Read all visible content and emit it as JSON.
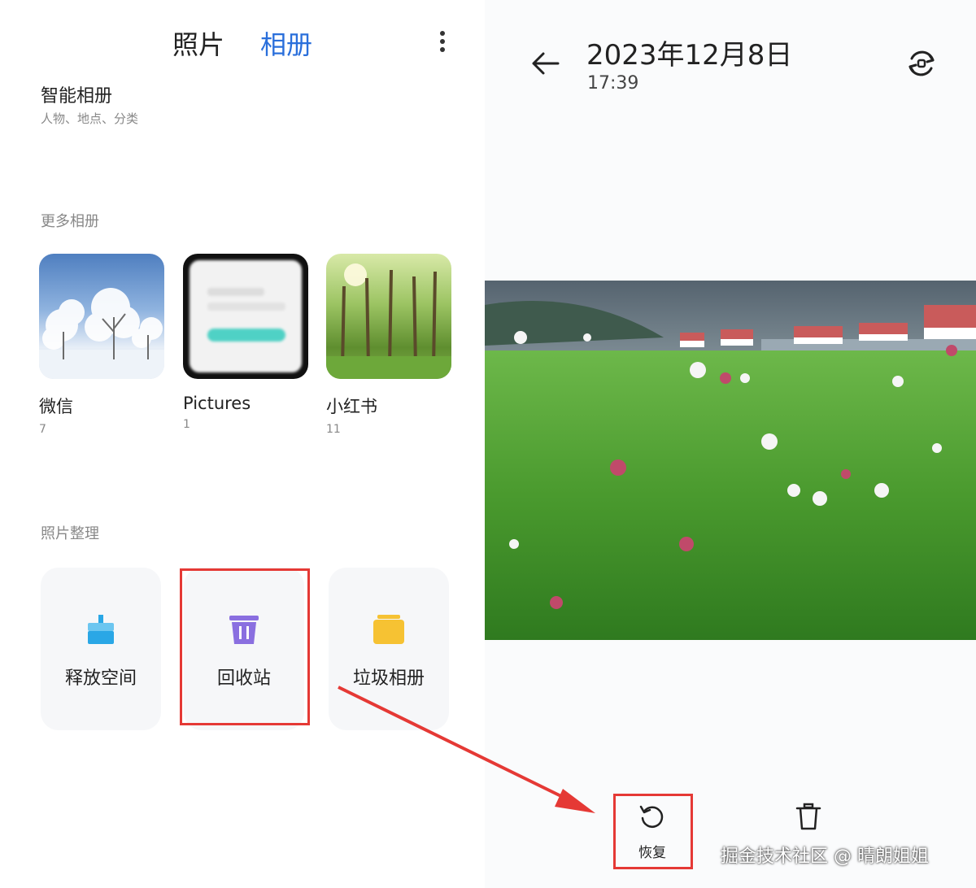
{
  "left": {
    "tabs": [
      {
        "label": "照片",
        "active": false
      },
      {
        "label": "相册",
        "active": true
      }
    ],
    "smart_album": {
      "title": "智能相册",
      "subtitle": "人物、地点、分类"
    },
    "more_albums": {
      "label": "更多相册",
      "items": [
        {
          "name": "微信",
          "count": "7"
        },
        {
          "name": "Pictures",
          "count": "1"
        },
        {
          "name": "小红书",
          "count": "11"
        }
      ]
    },
    "organize": {
      "label": "照片整理",
      "tools": [
        {
          "label": "释放空间",
          "icon": "broom-icon"
        },
        {
          "label": "回收站",
          "icon": "trash-icon"
        },
        {
          "label": "垃圾相册",
          "icon": "folder-icon"
        }
      ]
    }
  },
  "viewer": {
    "date": "2023年12月8日",
    "time": "17:39",
    "actions": [
      {
        "label": "恢复",
        "icon": "restore-icon"
      },
      {
        "label": "",
        "icon": "delete-icon"
      }
    ]
  },
  "watermark": "掘金技术社区 @ 晴朗姐姐",
  "colors": {
    "accent": "#2a6fdb",
    "highlight": "#e53935",
    "trash": "#8a6fe0",
    "broom": "#2aa7e6",
    "folder": "#f6c233"
  }
}
